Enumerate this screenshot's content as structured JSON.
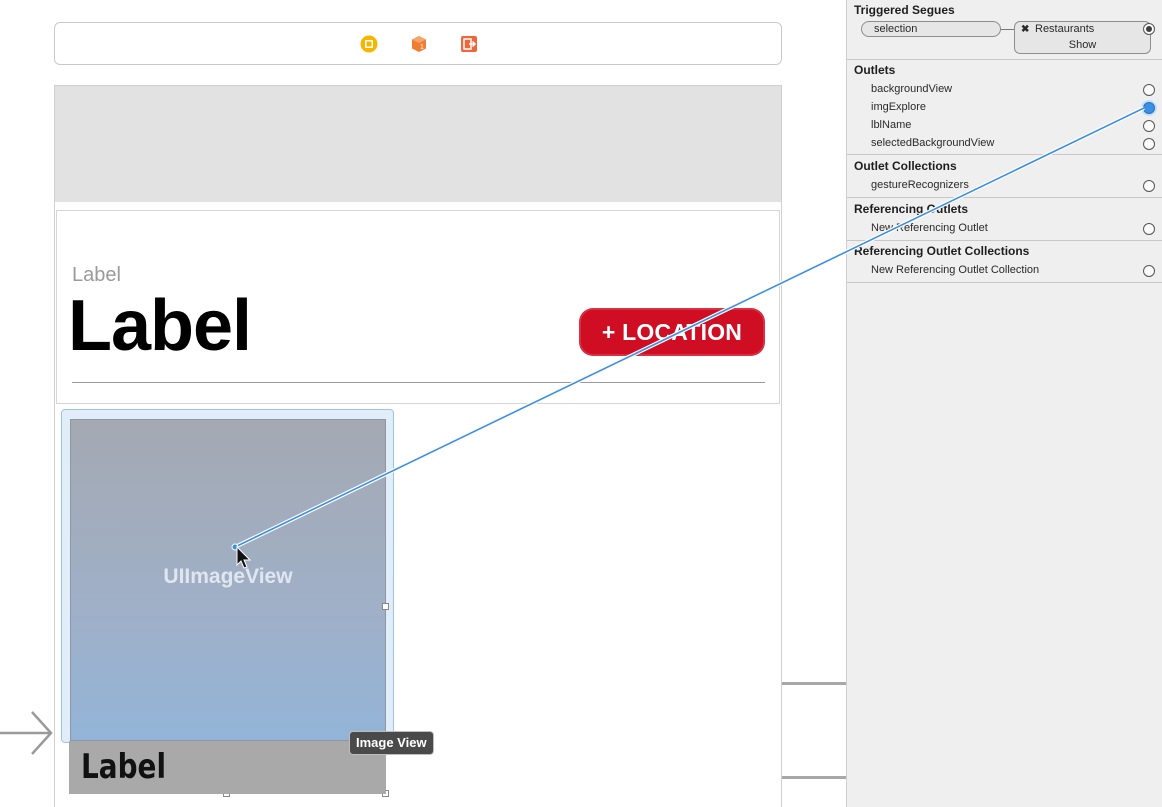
{
  "canvas": {
    "subtitle_label": "Label",
    "title_label": "Label",
    "location_button": "+ LOCATION",
    "image_view_caption": "UIImageView",
    "bottom_label": "Label",
    "tooltip": "Image View",
    "dock_icons": [
      "view-controller-icon",
      "first-responder-icon",
      "exit-icon"
    ],
    "colors": {
      "location_button": "#cf0d23",
      "dock_vc": "#f7b500",
      "dock_first": "#f07d34",
      "dock_exit": "#f0663a",
      "connection": "#3b8fe4"
    }
  },
  "inspector": {
    "triggered_segues": {
      "title": "Triggered Segues",
      "source": "selection",
      "destination": "Restaurants",
      "kind": "Show"
    },
    "outlets": {
      "title": "Outlets",
      "items": [
        "backgroundView",
        "imgExplore",
        "lblName",
        "selectedBackgroundView"
      ]
    },
    "outlet_collections": {
      "title": "Outlet Collections",
      "items": [
        "gestureRecognizers"
      ]
    },
    "referencing_outlets": {
      "title": "Referencing Outlets",
      "items": [
        "New Referencing Outlet"
      ]
    },
    "referencing_outlet_collections": {
      "title": "Referencing Outlet Collections",
      "items": [
        "New Referencing Outlet Collection"
      ]
    }
  }
}
